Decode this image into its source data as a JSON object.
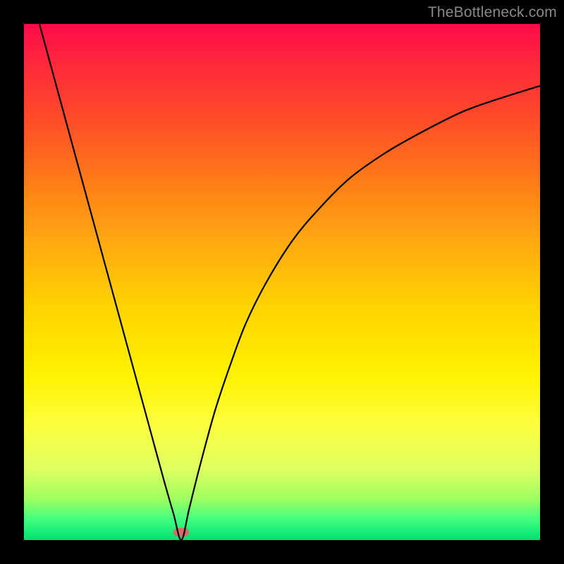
{
  "watermark": "TheBottleneck.com",
  "marker": {
    "cx_frac": 0.305,
    "cy_frac": 0.985
  },
  "chart_data": {
    "type": "line",
    "title": "",
    "xlabel": "",
    "ylabel": "",
    "xlim": [
      0,
      1
    ],
    "ylim": [
      0,
      1
    ],
    "x": [
      0.03,
      0.06,
      0.09,
      0.12,
      0.15,
      0.18,
      0.21,
      0.24,
      0.27,
      0.29,
      0.305,
      0.32,
      0.34,
      0.37,
      0.4,
      0.43,
      0.47,
      0.52,
      0.57,
      0.63,
      0.7,
      0.77,
      0.85,
      0.92,
      1.0
    ],
    "y": [
      1.0,
      0.89,
      0.78,
      0.67,
      0.56,
      0.45,
      0.34,
      0.23,
      0.12,
      0.05,
      0.0,
      0.06,
      0.14,
      0.25,
      0.34,
      0.42,
      0.5,
      0.58,
      0.64,
      0.7,
      0.75,
      0.79,
      0.83,
      0.855,
      0.88
    ],
    "background_gradient": {
      "top": "#ff0a4a",
      "mid": "#ffd400",
      "bottom": "#00e070"
    },
    "marker_point": {
      "x": 0.305,
      "y": 0.015,
      "color": "#d86a6a"
    }
  }
}
